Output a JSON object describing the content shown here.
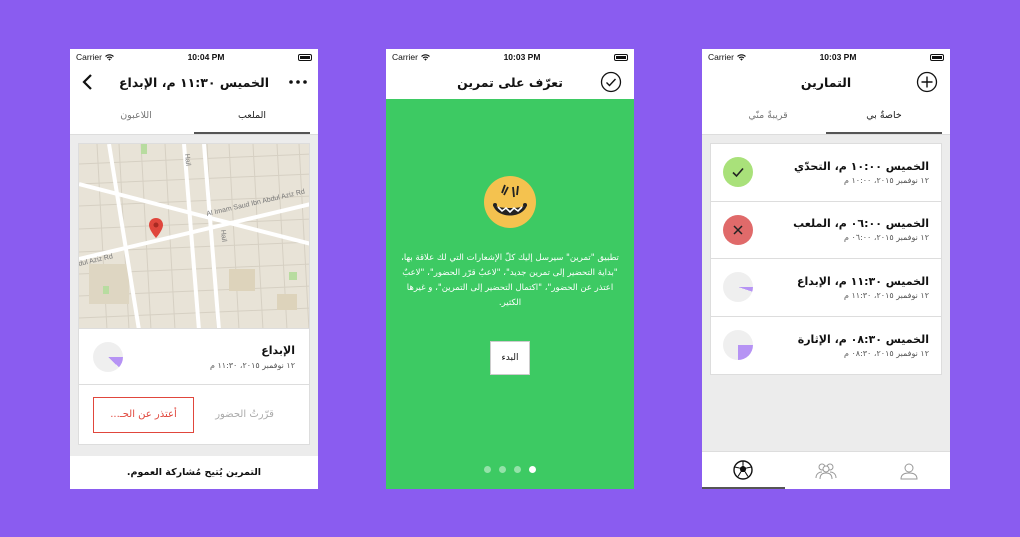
{
  "status": {
    "carrier": "Carrier"
  },
  "screen1": {
    "time": "10:04 PM",
    "title": "الخميس ١١:٣٠ م، الإبداع",
    "tabs": [
      "الملعب",
      "اللاعبون"
    ],
    "map_labels": [
      "Al Imam Saud Ibn Abdul Aziz Rd",
      "dul Aziz Rd",
      "Hail",
      "Hail"
    ],
    "event_name": "الإبداع",
    "event_date": "١٢ نوفمبر ٢٠١٥، ١١:٣٠ م",
    "attending_label": "قرّرتُ الحضور",
    "excuse_label": "أعتذر عن الحـ...",
    "footer": "التمرين يُتيح مُشاركة العموم."
  },
  "screen2": {
    "time": "10:03 PM",
    "title": "تعرّف على تمرين",
    "body": "تطبيق \"تمرين\" سيرسل إليك كلّ الإشعارات التي لك علاقة بها، \"بداية التحضير إلى تمرين جديد\"، \"لاعبٌ قرّر الحضور\"، \"لاعبٌ اعتذر عن الحضور\"، \"اكتمال التحضير إلى التمرين\"، و غيرها الكثير.",
    "start_label": "البدء",
    "page_count": 4,
    "active_page": 4
  },
  "screen3": {
    "time": "10:03 PM",
    "title": "التمارين",
    "tabs": [
      "خاصةٌ بي",
      "قريبةٌ منّي"
    ],
    "items": [
      {
        "title": "الخميس ١٠:٠٠ م، التحدّي",
        "date": "١٢ نوفمبر ٢٠١٥، ١٠:٠٠ م",
        "status": "accepted"
      },
      {
        "title": "الخميس ٠٦:٠٠ م، الملعب",
        "date": "١٢ نوفمبر ٢٠١٥، ٠٦:٠٠ م",
        "status": "declined"
      },
      {
        "title": "الخميس ١١:٣٠ م، الإبداع",
        "date": "١٢ نوفمبر ٢٠١٥، ١١:٣٠ م",
        "status": "pending",
        "progress": 0.05
      },
      {
        "title": "الخميس ٠٨:٣٠ م، الإثارة",
        "date": "١٢ نوفمبر ٢٠١٥، ٠٨:٣٠ م",
        "status": "pending",
        "progress": 0.25
      }
    ]
  },
  "colors": {
    "background": "#8a5cf0",
    "green": "#3dca63",
    "red": "#e0463c",
    "accept": "#a9e17a",
    "decline": "#e06a6a",
    "purple": "#b693f4"
  },
  "icons": [
    "wifi-icon",
    "battery-icon",
    "back-chevron-icon",
    "more-dots-icon",
    "map-pin-icon",
    "check-circle-icon",
    "mascot-face-icon",
    "plus-circle-icon",
    "checkmark-icon",
    "x-icon",
    "soccer-ball-icon",
    "team-icon",
    "profile-icon"
  ]
}
